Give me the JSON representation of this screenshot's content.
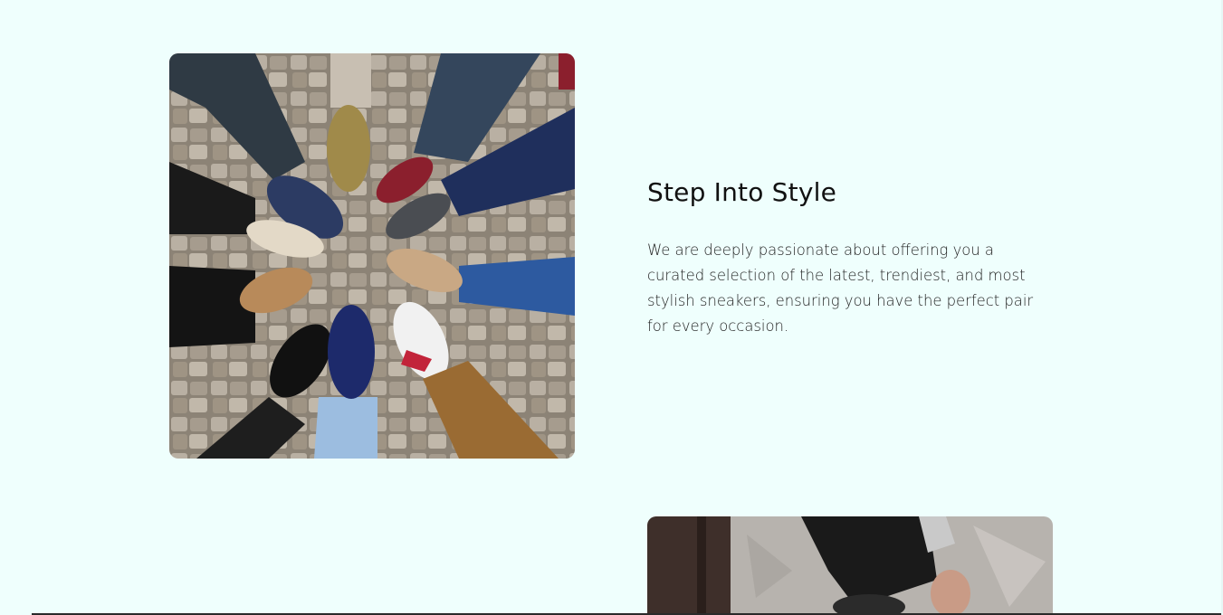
{
  "feature_1": {
    "image_alt": "Circle of feet in assorted sneakers on cobblestones",
    "title": "Step Into Style",
    "body": "We are deeply passionate about offering you a curated selection of the latest, trendiest, and most stylish sneakers, ensuring you have the perfect pair for every occasion."
  },
  "feature_2": {
    "image_alt": "Person in dark jeans and sneakers on a concrete floor"
  },
  "colors": {
    "page_background": "#effffd",
    "title_text": "#111111",
    "body_text": "#222222"
  }
}
